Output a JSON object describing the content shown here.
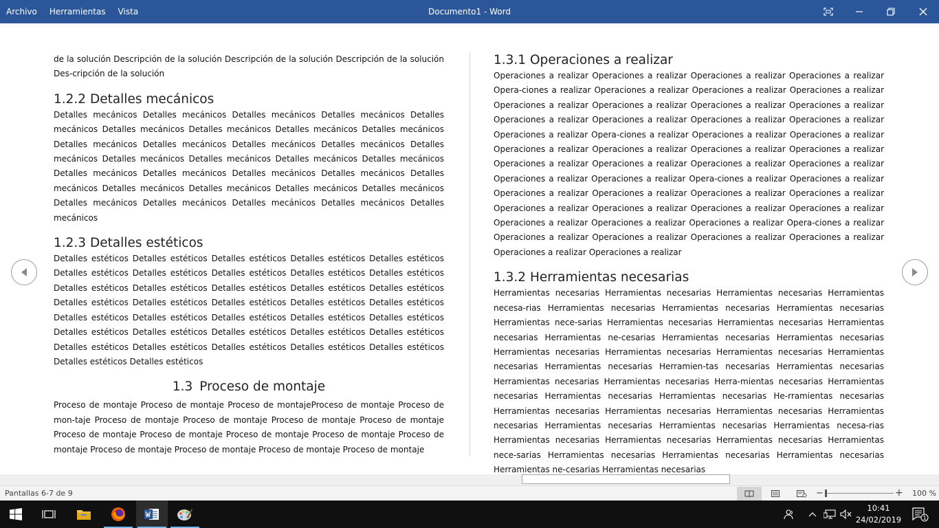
{
  "titlebar": {
    "menu": [
      "Archivo",
      "Herramientas",
      "Vista"
    ],
    "title": "Documento1 - Word"
  },
  "left_column": {
    "intro_text": "de la solución Descripción de la solución Descripción de la solución Descripción de la solución Des-cripción de la solución",
    "sections": [
      {
        "heading": "1.2.2 Detalles mecánicos",
        "body": "Detalles mecánicos Detalles mecánicos Detalles mecánicos Detalles mecánicos Detalles mecánicos Detalles mecánicos Detalles mecánicos Detalles mecánicos Detalles mecánicos Detalles mecánicos Detalles mecánicos Detalles mecánicos Detalles mecánicos Detalles mecánicos Detalles mecánicos Detalles mecánicos Detalles mecánicos Detalles mecánicos Detalles mecánicos Detalles mecánicos Detalles mecánicos Detalles mecánicos Detalles mecánicos Detalles mecánicos Detalles mecánicos Detalles mecánicos Detalles mecánicos Detalles mecánicos Detalles mecánicos Detalles mecánicos Detalles mecánicos Detalles mecánicos"
      },
      {
        "heading": "1.2.3 Detalles estéticos",
        "body": "Detalles estéticos Detalles estéticos Detalles estéticos Detalles estéticos Detalles estéticos Detalles estéticos Detalles estéticos Detalles estéticos Detalles estéticos Detalles estéticos Detalles estéticos Detalles estéticos Detalles estéticos Detalles estéticos Detalles estéticos Detalles estéticos Detalles estéticos Detalles estéticos Detalles estéticos Detalles estéticos Detalles estéticos Detalles estéticos Detalles estéticos Detalles estéticos Detalles estéticos Detalles estéticos Detalles estéticos Detalles estéticos Detalles estéticos Detalles estéticos Detalles estéticos Detalles estéticos Detalles estéticos Detalles estéticos Detalles estéticos Detalles estéticos Detalles estéticos"
      }
    ],
    "section_heading_num": "1.3",
    "section_heading_text": "Proceso de montaje",
    "section_body": "Proceso de montaje Proceso de montaje Proceso de montajeProceso de montaje Proceso de mon-taje Proceso de montaje Proceso de montaje Proceso de montaje Proceso de montaje Proceso de montaje Proceso de montaje Proceso de montaje Proceso de montaje Proceso de montaje Proceso de montaje Proceso de montaje Proceso de montaje Proceso de montaje"
  },
  "right_column": {
    "sections": [
      {
        "heading": "1.3.1 Operaciones a realizar",
        "body": "Operaciones a realizar Operaciones a realizar Operaciones a realizar Operaciones a realizar Opera-ciones a realizar Operaciones a realizar Operaciones a realizar Operaciones a realizar Operaciones a realizar Operaciones a realizar Operaciones a realizar Operaciones a realizar Operaciones a realizar Operaciones a realizar Operaciones a realizar Operaciones a realizar Operaciones a realizar Opera-ciones a realizar Operaciones a realizar Operaciones a realizar Operaciones a realizar Operaciones a realizar Operaciones a realizar Operaciones a realizar Operaciones a realizar Operaciones a realizar Operaciones a realizar Operaciones a realizar Operaciones a realizar Operaciones a realizar Opera-ciones a realizar Operaciones a realizar Operaciones a realizar Operaciones a realizar Operaciones a realizar Operaciones a realizar Operaciones a realizar Operaciones a realizar Operaciones a realizar Operaciones a realizar Operaciones a realizar Operaciones a realizar Operaciones a realizar Opera-ciones a realizar Operaciones a realizar Operaciones a realizar Operaciones a realizar Operaciones a realizar Operaciones a realizar Operaciones a realizar"
      },
      {
        "heading": "1.3.2 Herramientas necesarias",
        "body": "Herramientas necesarias Herramientas necesarias Herramientas necesarias Herramientas necesa-rias Herramientas necesarias Herramientas necesarias Herramientas necesarias Herramientas nece-sarias Herramientas necesarias Herramientas necesarias Herramientas necesarias Herramientas ne-cesarias Herramientas necesarias Herramientas necesarias Herramientas necesarias Herramientas necesarias Herramientas necesarias Herramientas necesarias Herramientas necesarias Herramien-tas necesarias Herramientas necesarias Herramientas necesarias Herramientas necesarias Herra-mientas necesarias Herramientas necesarias Herramientas necesarias Herramientas necesarias He-rramientas necesarias Herramientas necesarias Herramientas necesarias Herramientas necesarias Herramientas necesarias Herramientas necesarias Herramientas necesarias Herramientas necesa-rias Herramientas necesarias Herramientas necesarias Herramientas necesarias Herramientas nece-sarias Herramientas necesarias Herramientas necesarias Herramientas necesarias Herramientas ne-cesarias Herramientas necesarias"
      }
    ]
  },
  "statusbar": {
    "page_info": "Pantallas 6-7 de 9",
    "zoom_level": "100 %",
    "zoom_minus": "−",
    "zoom_plus": "+"
  },
  "taskbar": {
    "time": "10:41",
    "date": "24/02/2019",
    "notification_count": "1"
  },
  "colors": {
    "title_bar": "#2b579a",
    "taskbar": "#101010",
    "taskbar_accent": "#76b9ed"
  },
  "icons": [
    "fullscreen-icon",
    "minimize-icon",
    "restore-icon",
    "close-icon",
    "previous-page-icon",
    "next-page-icon",
    "read-mode-icon",
    "print-layout-icon",
    "web-layout-icon",
    "windows-start-icon",
    "task-view-icon",
    "file-explorer-icon",
    "firefox-icon",
    "word-icon",
    "paint-icon",
    "people-icon",
    "chevron-up-icon",
    "network-icon",
    "volume-muted-icon",
    "notifications-icon"
  ]
}
